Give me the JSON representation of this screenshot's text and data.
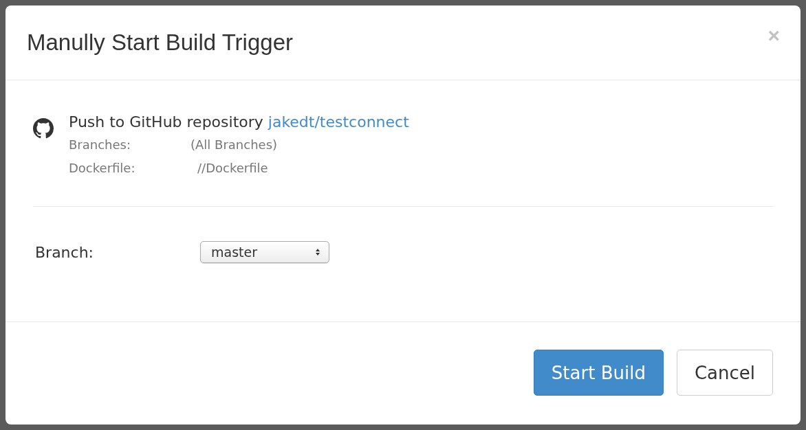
{
  "dialog": {
    "title": "Manully Start Build Trigger",
    "close": "×",
    "trigger": {
      "text": "Push to GitHub repository",
      "repository": "jakedt/testconnect",
      "details": [
        {
          "label": "Branches:",
          "value": "(All Branches)"
        },
        {
          "label": "Dockerfile:",
          "value": "//Dockerfile"
        }
      ]
    },
    "branch": {
      "label": "Branch:",
      "value": "master"
    },
    "buttons": [
      {
        "label": "Start Build",
        "kind": "primary"
      },
      {
        "label": "Cancel",
        "kind": "default"
      }
    ]
  }
}
